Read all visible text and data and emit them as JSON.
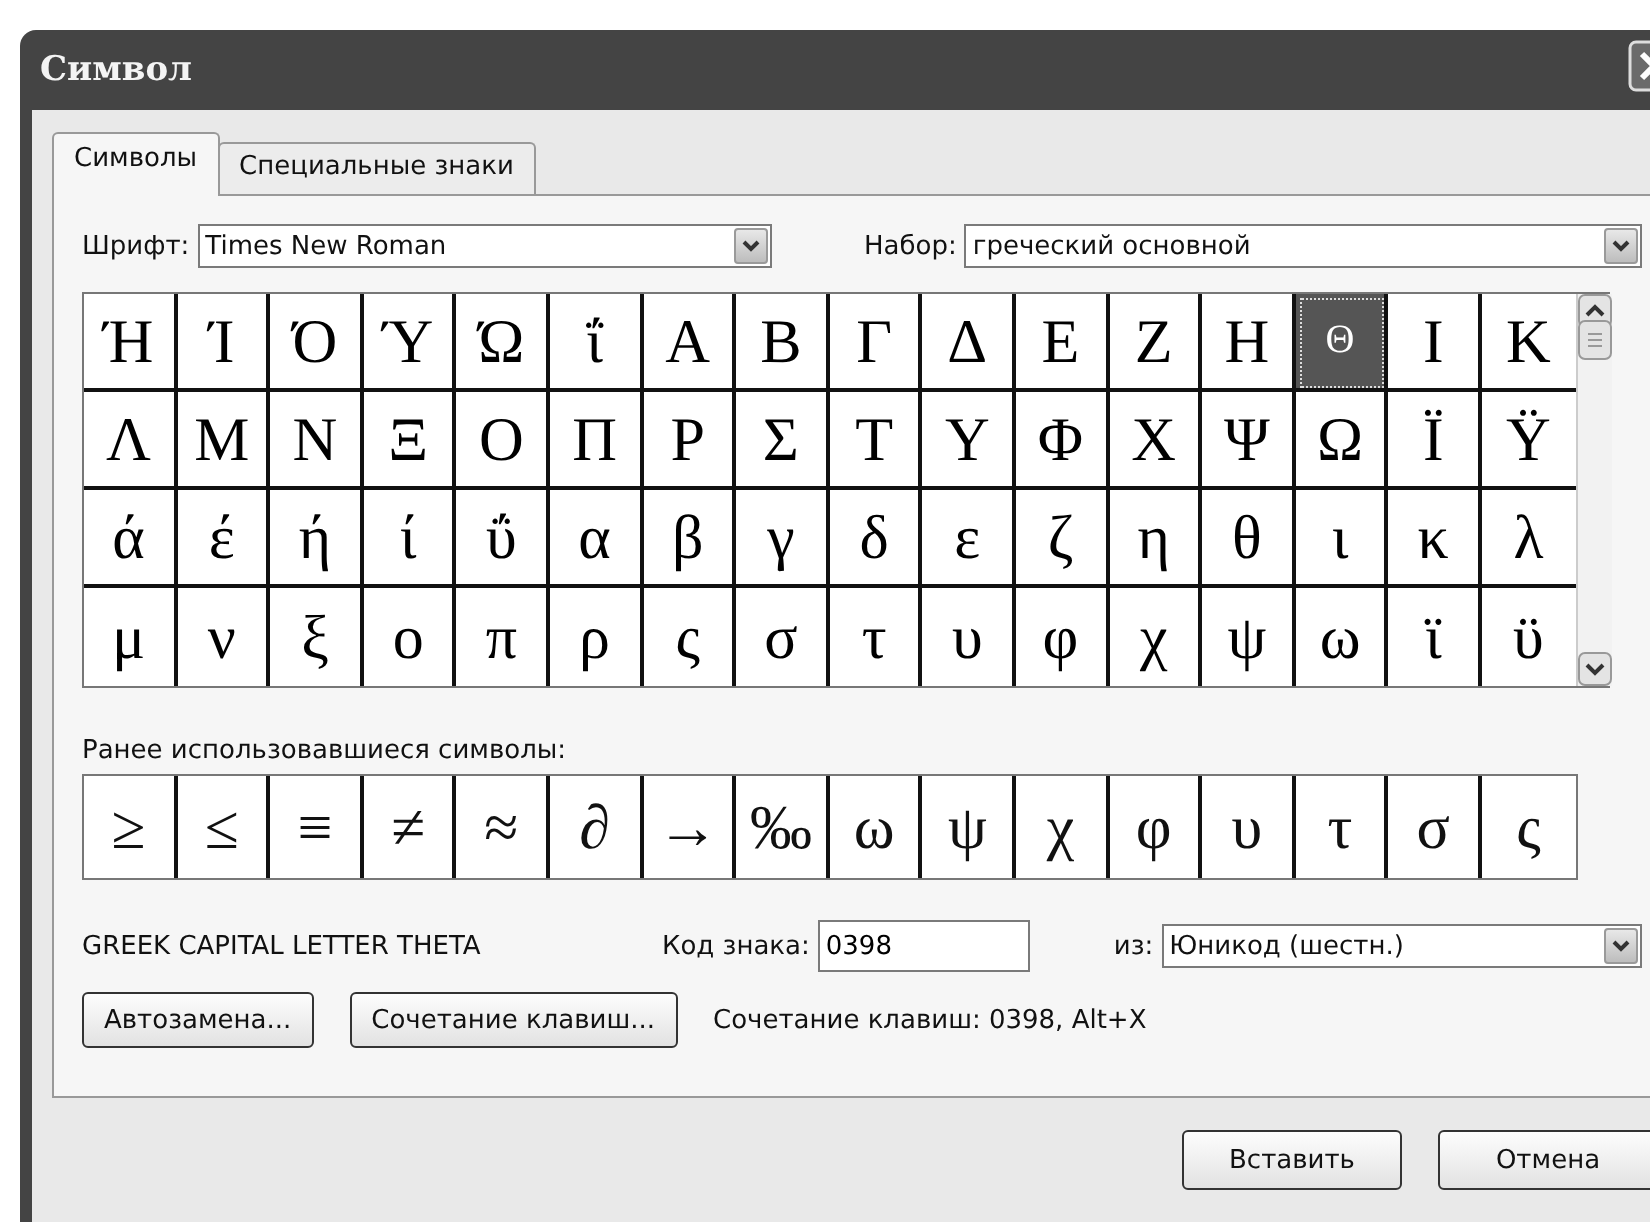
{
  "window": {
    "title": "Символ"
  },
  "tabs": [
    {
      "label": "Символы",
      "selected": true
    },
    {
      "label": "Специальные знаки",
      "selected": false
    }
  ],
  "font": {
    "label": "Шрифт:",
    "value": "Times New Roman"
  },
  "subset": {
    "label": "Набор:",
    "value": "греческий основной"
  },
  "symbols": [
    {
      "char": "Ή",
      "selected": false
    },
    {
      "char": "Ί",
      "selected": false
    },
    {
      "char": "Ό",
      "selected": false
    },
    {
      "char": "Ύ",
      "selected": false
    },
    {
      "char": "Ώ",
      "selected": false
    },
    {
      "char": "ΐ",
      "selected": false
    },
    {
      "char": "Α",
      "selected": false
    },
    {
      "char": "Β",
      "selected": false
    },
    {
      "char": "Γ",
      "selected": false
    },
    {
      "char": "Δ",
      "selected": false
    },
    {
      "char": "Ε",
      "selected": false
    },
    {
      "char": "Ζ",
      "selected": false
    },
    {
      "char": "Η",
      "selected": false
    },
    {
      "char": "Θ",
      "selected": true
    },
    {
      "char": "Ι",
      "selected": false
    },
    {
      "char": "Κ",
      "selected": false
    },
    {
      "char": "Λ",
      "selected": false
    },
    {
      "char": "Μ",
      "selected": false
    },
    {
      "char": "Ν",
      "selected": false
    },
    {
      "char": "Ξ",
      "selected": false
    },
    {
      "char": "Ο",
      "selected": false
    },
    {
      "char": "Π",
      "selected": false
    },
    {
      "char": "Ρ",
      "selected": false
    },
    {
      "char": "Σ",
      "selected": false
    },
    {
      "char": "Τ",
      "selected": false
    },
    {
      "char": "Υ",
      "selected": false
    },
    {
      "char": "Φ",
      "selected": false
    },
    {
      "char": "Χ",
      "selected": false
    },
    {
      "char": "Ψ",
      "selected": false
    },
    {
      "char": "Ω",
      "selected": false
    },
    {
      "char": "Ϊ",
      "selected": false
    },
    {
      "char": "Ϋ",
      "selected": false
    },
    {
      "char": "ά",
      "selected": false
    },
    {
      "char": "έ",
      "selected": false
    },
    {
      "char": "ή",
      "selected": false
    },
    {
      "char": "ί",
      "selected": false
    },
    {
      "char": "ΰ",
      "selected": false
    },
    {
      "char": "α",
      "selected": false
    },
    {
      "char": "β",
      "selected": false
    },
    {
      "char": "γ",
      "selected": false
    },
    {
      "char": "δ",
      "selected": false
    },
    {
      "char": "ε",
      "selected": false
    },
    {
      "char": "ζ",
      "selected": false
    },
    {
      "char": "η",
      "selected": false
    },
    {
      "char": "θ",
      "selected": false
    },
    {
      "char": "ι",
      "selected": false
    },
    {
      "char": "κ",
      "selected": false
    },
    {
      "char": "λ",
      "selected": false
    },
    {
      "char": "μ",
      "selected": false
    },
    {
      "char": "ν",
      "selected": false
    },
    {
      "char": "ξ",
      "selected": false
    },
    {
      "char": "ο",
      "selected": false
    },
    {
      "char": "π",
      "selected": false
    },
    {
      "char": "ρ",
      "selected": false
    },
    {
      "char": "ς",
      "selected": false
    },
    {
      "char": "σ",
      "selected": false
    },
    {
      "char": "τ",
      "selected": false
    },
    {
      "char": "υ",
      "selected": false
    },
    {
      "char": "φ",
      "selected": false
    },
    {
      "char": "χ",
      "selected": false
    },
    {
      "char": "ψ",
      "selected": false
    },
    {
      "char": "ω",
      "selected": false
    },
    {
      "char": "ϊ",
      "selected": false
    },
    {
      "char": "ϋ",
      "selected": false
    }
  ],
  "recent": {
    "label": "Ранее использовавшиеся символы:",
    "symbols": [
      "≥",
      "≤",
      "≡",
      "≠",
      "≈",
      "∂",
      "→",
      "‰",
      "ω",
      "ψ",
      "χ",
      "φ",
      "υ",
      "τ",
      "σ",
      "ς"
    ]
  },
  "description": "GREEK CAPITAL LETTER THETA",
  "char_code": {
    "label": "Код знака:",
    "value": "0398"
  },
  "from": {
    "label": "из:",
    "value": "Юникод (шестн.)"
  },
  "buttons": [
    "Автозамена...",
    "Сочетание клавиш..."
  ],
  "shortcut": "Сочетание клавиш: 0398, Alt+X",
  "dialog_buttons": [
    "Вставить",
    "Отмена"
  ]
}
